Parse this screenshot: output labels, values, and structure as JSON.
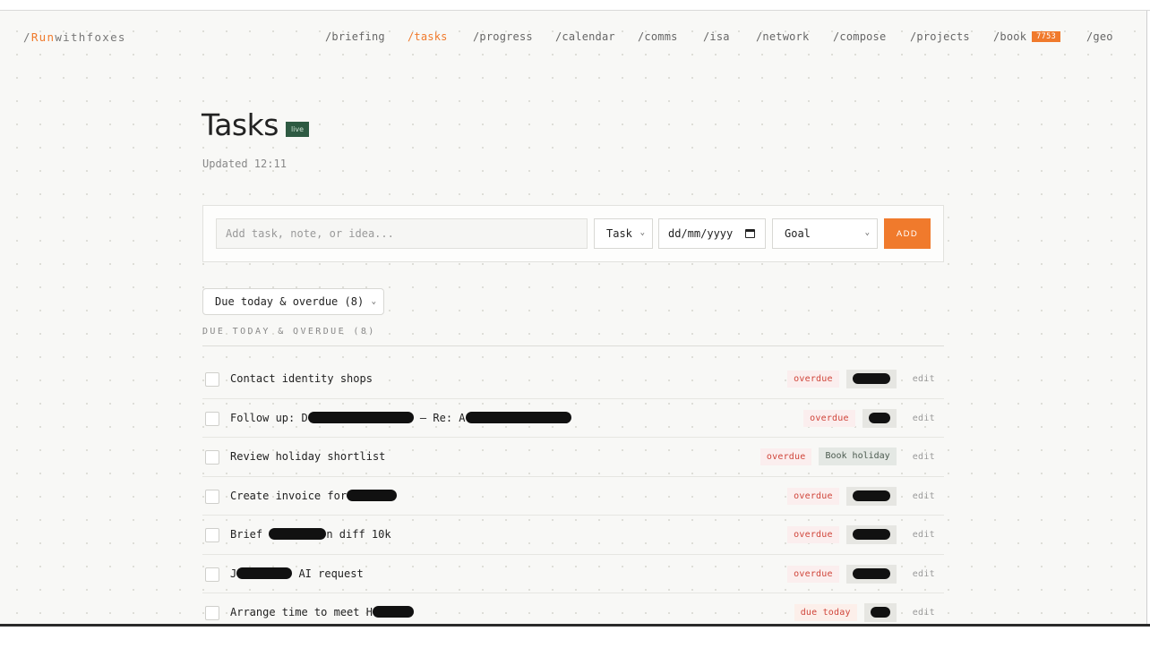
{
  "brand": {
    "slash": "/",
    "accent": "Run",
    "rest": "withfoxes"
  },
  "nav": [
    {
      "label": "/briefing",
      "active": false
    },
    {
      "label": "/tasks",
      "active": true
    },
    {
      "label": "/progress",
      "active": false
    },
    {
      "label": "/calendar",
      "active": false
    },
    {
      "label": "/comms",
      "active": false
    },
    {
      "label": "/isa",
      "active": false
    },
    {
      "label": "/network",
      "active": false
    },
    {
      "label": "/compose",
      "active": false
    },
    {
      "label": "/projects",
      "active": false
    },
    {
      "label": "/book",
      "badge": "7753",
      "active": false
    },
    {
      "label": "/geo",
      "active": false
    }
  ],
  "header": {
    "title": "Tasks",
    "live_badge": "live",
    "updated": "Updated 12:11"
  },
  "add_bar": {
    "placeholder": "Add task, note, or idea...",
    "type_value": "Task",
    "date_placeholder": "dd/mm/yyyy",
    "goal_value": "Goal",
    "add_label": "ADD"
  },
  "filter": {
    "selected": "Due today & overdue (8)",
    "heading": "DUE TODAY & OVERDUE (8)"
  },
  "colors": {
    "accent": "#f07a2c",
    "live": "#2e5a42",
    "overdue_text": "#d0453a"
  },
  "tasks": [
    {
      "text_before": "Contact identity shops",
      "redaction_width": 0,
      "text_after": "",
      "status": "overdue",
      "goal": "",
      "edit": "edit"
    },
    {
      "text_before": "Follow up: D",
      "redaction_width": 118,
      "text_after": " — Re: A",
      "redaction2_width": 118,
      "status": "overdue",
      "goal": "",
      "edit": "edit"
    },
    {
      "text_before": "Review holiday shortlist",
      "redaction_width": 0,
      "text_after": "",
      "status": "overdue",
      "goal": "Book holiday",
      "edit": "edit"
    },
    {
      "text_before": "Create invoice for",
      "redaction_width": 56,
      "text_after": "",
      "status": "overdue",
      "goal": "",
      "edit": "edit"
    },
    {
      "text_before": "Brief ",
      "redaction_width": 64,
      "text_after": "n diff 10k",
      "status": "overdue",
      "goal": "",
      "edit": "edit"
    },
    {
      "text_before": "J",
      "redaction_width": 62,
      "text_after": " AI request",
      "status": "overdue",
      "goal": "",
      "edit": "edit"
    },
    {
      "text_before": "Arrange time to meet H",
      "redaction_width": 46,
      "text_after": "",
      "status": "due today",
      "goal": "",
      "edit": "edit"
    }
  ]
}
